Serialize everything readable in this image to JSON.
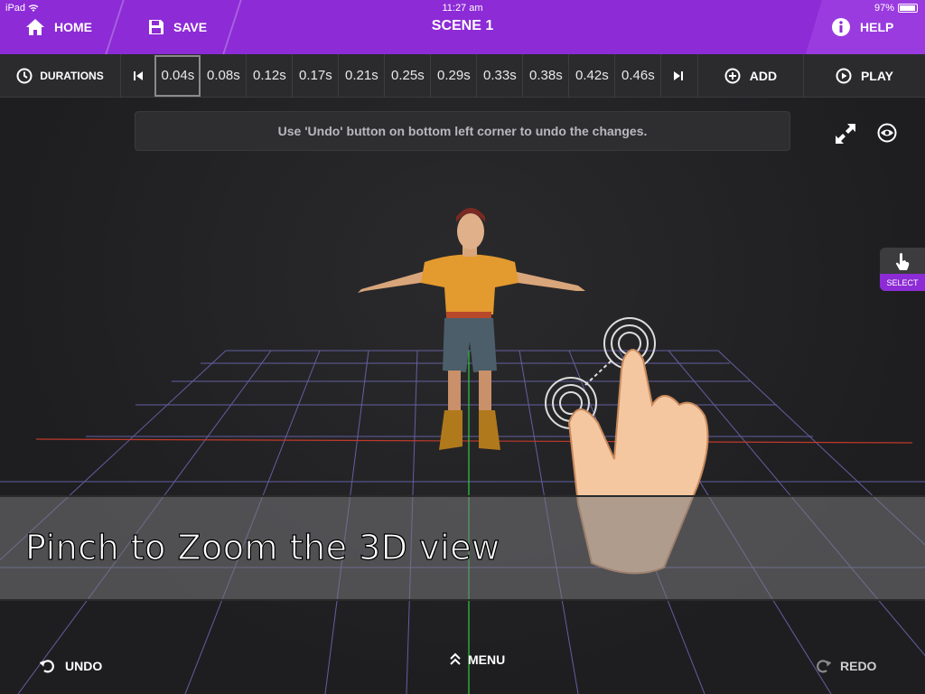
{
  "status": {
    "device": "iPad",
    "time": "11:27 am",
    "battery": "97%"
  },
  "header": {
    "home_label": "HOME",
    "save_label": "SAVE",
    "title": "SCENE 1",
    "help_label": "HELP"
  },
  "timeline": {
    "durations_label": "DURATIONS",
    "frames": [
      "0.04s",
      "0.08s",
      "0.12s",
      "0.17s",
      "0.21s",
      "0.25s",
      "0.29s",
      "0.33s",
      "0.38s",
      "0.42s",
      "0.46s"
    ],
    "selected_frame": "0.04s",
    "add_label": "ADD",
    "play_label": "PLAY"
  },
  "viewport": {
    "notice": "Use 'Undo' button on bottom left corner to undo the changes.",
    "select_label": "SELECT",
    "tutorial_caption": "Pinch to Zoom the 3D view"
  },
  "footer": {
    "undo_label": "UNDO",
    "menu_label": "MENU",
    "redo_label": "REDO"
  },
  "colors": {
    "accent": "#8d2bd6",
    "toolbar": "#2b2b2e",
    "background": "#1f1f21",
    "grid_line": "#7a74c8",
    "x_axis": "#c0392b",
    "z_axis": "#2ecc40"
  }
}
